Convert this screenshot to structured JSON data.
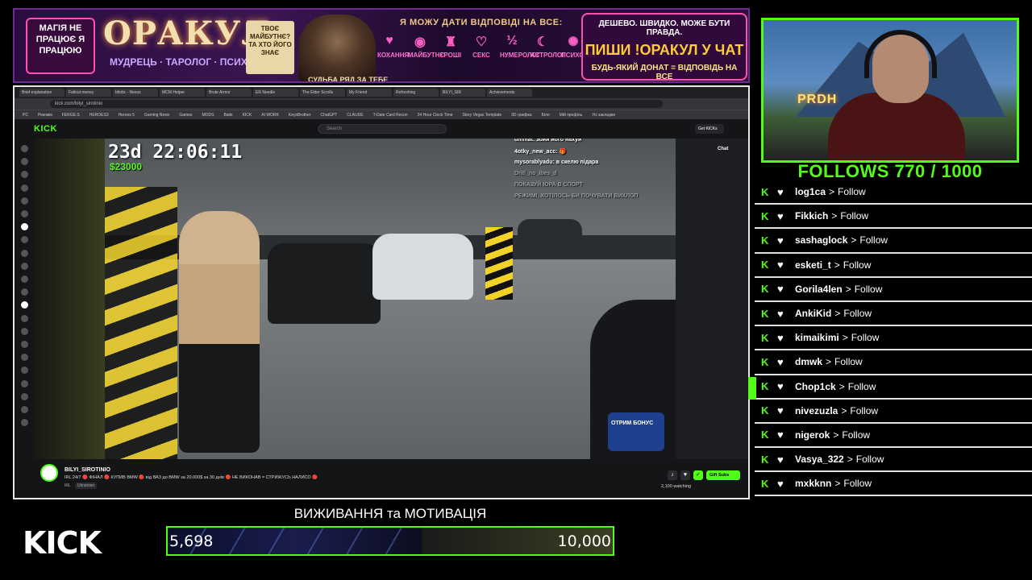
{
  "banner": {
    "magic_text": "МАГІЯ НЕ ПРАЦЮЄ Я ПРАЦЮЮ",
    "title": "ОРАКУЛ",
    "subtitle": "МУДРЕЦЬ · ТАРОЛОГ · ПСИХОЛОГ",
    "parchment_text": "ТВОЄ МАЙБУТНЄ? ТА ХТО ЙОГО ЗНАЄ",
    "wizard_sign": "СУДЬБА РЯД ЗА ТЕБЕ",
    "answers": "Я МОЖУ ДАТИ ВІДПОВІДІ НА ВСЕ:",
    "categories": [
      {
        "icon": "heart-icon",
        "glyph": "♥",
        "label": "КОХАННЯ"
      },
      {
        "icon": "crystal-ball-icon",
        "glyph": "◉",
        "label": "МАЙБУТНЄ"
      },
      {
        "icon": "money-icon",
        "glyph": "♜",
        "label": "ГРОШІ"
      },
      {
        "icon": "heart-outline-icon",
        "glyph": "♡",
        "label": "СЕКС"
      },
      {
        "icon": "numbers-icon",
        "glyph": "½",
        "label": "НУМЕРОЛОГ"
      },
      {
        "icon": "moon-icon",
        "glyph": "☾",
        "label": "АСТРОЛОГ"
      },
      {
        "icon": "brain-icon",
        "glyph": "✺",
        "label": "ПСИХОЛОГ"
      }
    ],
    "cta_top": "ДЕШЕВО. ШВИДКО. МОЖЕ БУТИ ПРАВДА.",
    "cta_main": "ПИШИ !ОРАКУЛ У ЧАТ",
    "cta_bottom": "БУДЬ-ЯКИЙ ДОНАТ = ВІДПОВІДЬ НА ВСЕ"
  },
  "browser": {
    "tabs": [
      "Brief explanation",
      "Fallout money",
      "Idiotic - Nexus",
      "MCM Helper",
      "Brute Armor",
      "ER Needle",
      "The Elder Scrolls",
      "My Friend",
      "Refreshing",
      "BILYI_SIR",
      "Achievements"
    ],
    "url": "kick.com/bilyi_sirotinio",
    "bookmarks": [
      "PC",
      "Рекомм",
      "FERGE.S",
      "HEROES3",
      "Heroes 5",
      "Gaming News",
      "Games",
      "MODS",
      "Baits",
      "KICK",
      "AI WORK",
      "KeysBrother",
      "ChatGPT",
      "CLAUDE",
      "T-Date Card Recon",
      "24 Hour Clock Time",
      "Story Vegas Template",
      "3D графіка",
      "Біло",
      "Мій профіль",
      "Усі закладки"
    ]
  },
  "kick": {
    "logo": "KICK",
    "search_placeholder": "Search",
    "get_kicks": "Get KICKs",
    "chat_label": "Chat",
    "channel_name": "BILYI_SIROTINIO",
    "stream_title": "IRL 24/7 🔴 ФІНАЛ 🔴 КУПИВ BMW 🔴 від ВАЗ до BMW за 20.000$ за 30 днів 🔴 НЕ ВИКОНАВ = СТРИЖУСЬ НАЛИСО 🔴",
    "category": "IRL",
    "language": "Ukrainian",
    "viewers": "2,100 watching",
    "gift_subs": "Gift Subs"
  },
  "video": {
    "timer": "23d 22:06:11",
    "money": "$23000",
    "chat": [
      {
        "text": "dmmat: зойи його нахуи",
        "ghost": false
      },
      {
        "text": "4otky_new_acc: 🎁",
        "ghost": false
      },
      {
        "text": "mysorablyadu: в скелю підара",
        "ghost": false
      },
      {
        "text": "Dritl_no_ibes_d",
        "ghost": true
      },
      {
        "text": "ПОКАЗУЙ ЮРА В СПОРТ",
        "ghost": true
      },
      {
        "text": "РЕЖИМІ, ХОТІЛОСЬ БИ ПОЧУВАТИ ВИХЛОП",
        "ghost": true
      }
    ],
    "bonus_text": "ОТРИМ БОНУС"
  },
  "follows": {
    "title": "FOLLOWS 770 / 1000",
    "items": [
      {
        "name": "log1ca",
        "action": "Follow"
      },
      {
        "name": "Fikkich",
        "action": "Follow"
      },
      {
        "name": "sashaglock",
        "action": "Follow"
      },
      {
        "name": "esketi_t",
        "action": "Follow"
      },
      {
        "name": "Gorila4len",
        "action": "Follow"
      },
      {
        "name": "AnkiKid",
        "action": "Follow"
      },
      {
        "name": "kimaikimi",
        "action": "Follow"
      },
      {
        "name": "dmwk",
        "action": "Follow"
      },
      {
        "name": "Chop1ck",
        "action": "Follow",
        "active": true
      },
      {
        "name": "nivezuzla",
        "action": "Follow"
      },
      {
        "name": "nigerok",
        "action": "Follow"
      },
      {
        "name": "Vasya_322",
        "action": "Follow"
      },
      {
        "name": "mxkknn",
        "action": "Follow"
      }
    ],
    "arrow": ">"
  },
  "goal": {
    "logo": "KICK",
    "title": "ВИЖИВАННЯ та МОТИВАЦІЯ",
    "current": 5698,
    "current_label": "5,698",
    "target": 10000,
    "target_label": "10,000"
  },
  "colors": {
    "kick_green": "#53fc18",
    "banner_purple": "#6b2d8f",
    "accent_pink": "#ff4fb5"
  }
}
